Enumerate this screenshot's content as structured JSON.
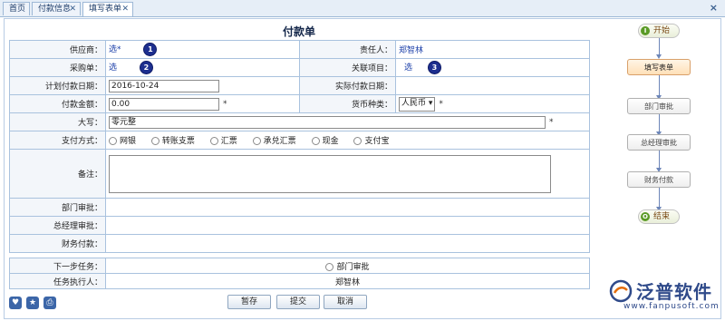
{
  "tabs": [
    {
      "label": "首页"
    },
    {
      "label": "付款信息"
    },
    {
      "label": "填写表单"
    }
  ],
  "window_close": "×",
  "form": {
    "title": "付款单",
    "supplier_label": "供应商：",
    "supplier_link": "选*",
    "responsible_label": "责任人：",
    "responsible_value": "郑智林",
    "po_label": "采购单：",
    "po_link": "选",
    "related_label": "关联项目：",
    "related_link": "选",
    "planned_date_label": "计划付款日期：",
    "planned_date_value": "2016-10-24",
    "actual_date_label": "实际付款日期：",
    "amount_label": "付款金额：",
    "amount_value": "0.00",
    "amount_req": "*",
    "currency_label": "货币种类：",
    "currency_value": "人民币",
    "currency_req": "*",
    "uppercase_label": "大写：",
    "uppercase_value": "零元整",
    "uppercase_req": "*",
    "payment_method_label": "支付方式：",
    "payment_methods": [
      "网银",
      "转账支票",
      "汇票",
      "承兑汇票",
      "现金",
      "支付宝"
    ],
    "remark_label": "备注：",
    "dept_approval_label": "部门审批：",
    "gm_approval_label": "总经理审批：",
    "finance_label": "财务付款：",
    "next_task_label": "下一步任务：",
    "next_task_value": "部门审批",
    "executor_label": "任务执行人：",
    "executor_value": "郑智林"
  },
  "badges": [
    "1",
    "2",
    "3"
  ],
  "buttons": {
    "save": "暂存",
    "submit": "提交",
    "cancel": "取消"
  },
  "flow": {
    "start": "开始",
    "start_icon": "I",
    "steps": [
      "填写表单",
      "部门审批",
      "总经理审批",
      "财务付款"
    ],
    "end": "结束",
    "end_icon": "O"
  },
  "bottom_icons": [
    "heart-icon",
    "star-icon",
    "print-icon"
  ],
  "logo": {
    "name": "泛普软件",
    "url": "www.fanpusoft.com"
  },
  "colors": {
    "link": "#1a3ea8",
    "current_step": "#ffe0b8",
    "table_border": "#a9c2de",
    "logo": "#2f4a8a"
  }
}
